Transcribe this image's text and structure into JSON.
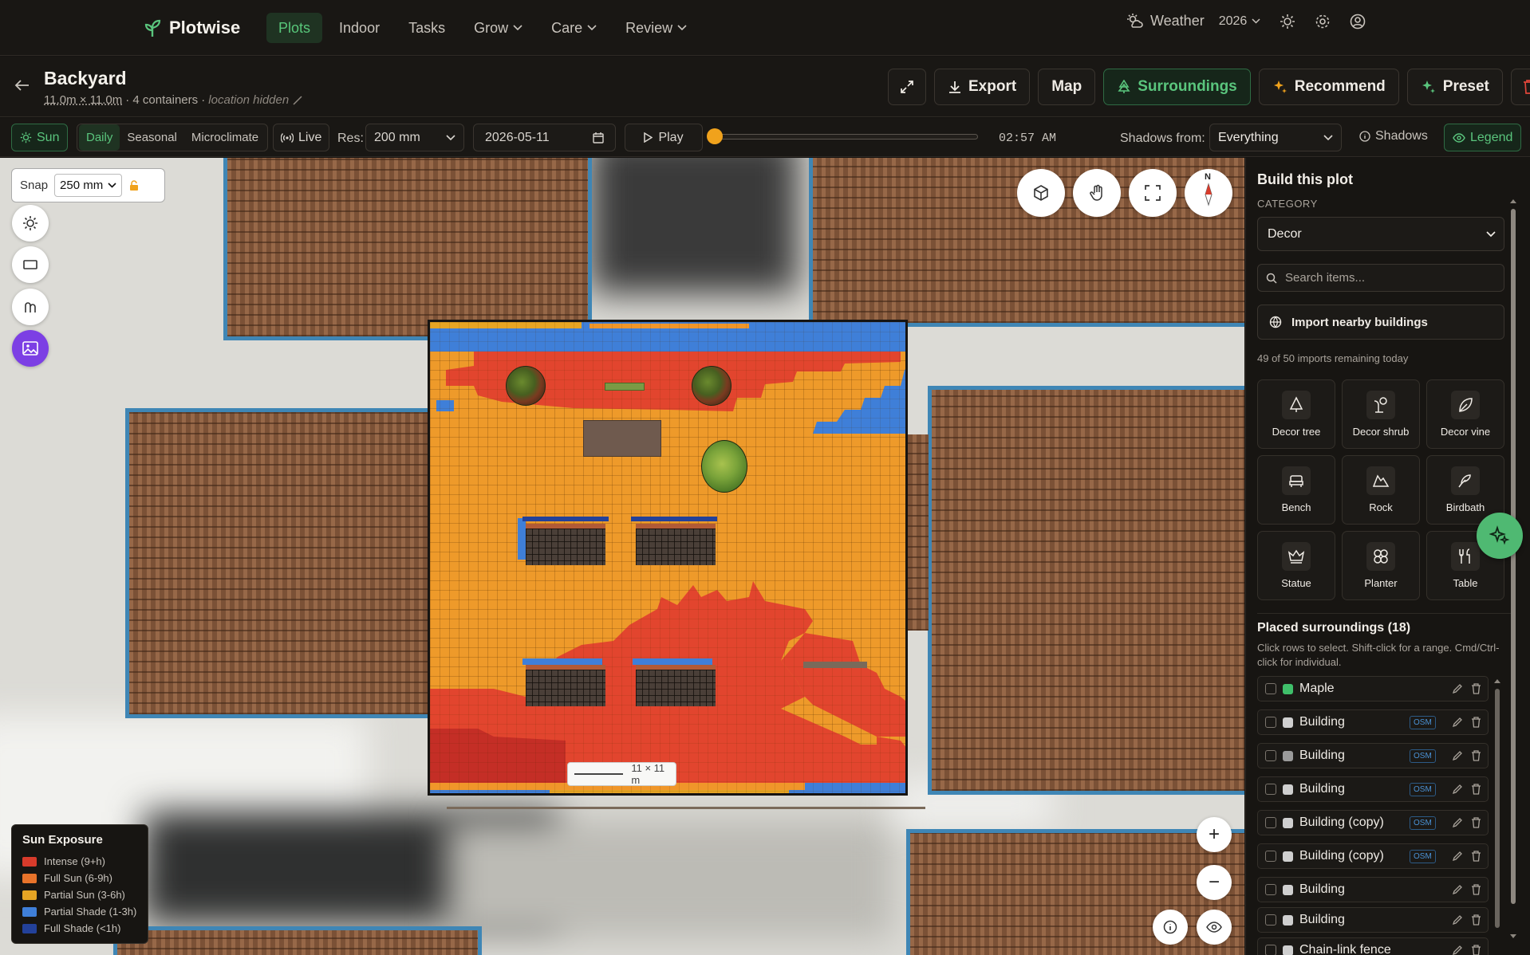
{
  "nav": {
    "brand": "Plotwise",
    "items": [
      {
        "label": "Plots",
        "active": true
      },
      {
        "label": "Indoor"
      },
      {
        "label": "Tasks"
      },
      {
        "label": "Grow",
        "dropdown": true
      },
      {
        "label": "Care",
        "dropdown": true
      },
      {
        "label": "Review",
        "dropdown": true
      }
    ],
    "weather": "Weather",
    "year": "2026"
  },
  "header": {
    "title": "Backyard",
    "dimensions": "11.0m × 11.0m",
    "containers": "· 4 containers ·",
    "location": "location hidden",
    "buttons": {
      "export": "Export",
      "map": "Map",
      "surroundings": "Surroundings",
      "recommend": "Recommend",
      "preset": "Preset"
    }
  },
  "toolbar": {
    "sun": "Sun",
    "modes": [
      "Daily",
      "Seasonal",
      "Microclimate"
    ],
    "live": "Live",
    "res_label": "Res:",
    "res_value": "200 mm",
    "date": "2026-05-11",
    "play": "Play",
    "time": "02:57 AM",
    "time_fraction": 0.0,
    "shadows_from_label": "Shadows from:",
    "shadows_from_value": "Everything",
    "shadows": "Shadows",
    "legend": "Legend"
  },
  "map": {
    "snap_label": "Snap",
    "snap_value": "250 mm",
    "compass": "N",
    "scale": "11 × 11 m",
    "zoom_in": "+",
    "zoom_out": "−"
  },
  "legend": {
    "title": "Sun Exposure",
    "items": [
      {
        "label": "Intense (9+h)",
        "color": "#d83b2b"
      },
      {
        "label": "Full Sun (6-9h)",
        "color": "#e8732a"
      },
      {
        "label": "Partial Sun (3-6h)",
        "color": "#e6a524"
      },
      {
        "label": "Partial Shade (1-3h)",
        "color": "#3f7fd8"
      },
      {
        "label": "Full Shade (<1h)",
        "color": "#23419a"
      }
    ]
  },
  "panel": {
    "title": "Build this plot",
    "category_label": "CATEGORY",
    "category_value": "Decor",
    "search_placeholder": "Search items...",
    "import_button": "Import nearby buildings",
    "imports_remaining": "49 of 50 imports remaining today",
    "items": [
      {
        "label": "Decor tree",
        "icon": "tree-icon"
      },
      {
        "label": "Decor shrub",
        "icon": "shrub-icon"
      },
      {
        "label": "Decor vine",
        "icon": "vine-icon"
      },
      {
        "label": "Bench",
        "icon": "bench-icon"
      },
      {
        "label": "Rock",
        "icon": "rock-icon"
      },
      {
        "label": "Birdbath",
        "icon": "birdbath-icon"
      },
      {
        "label": "Statue",
        "icon": "statue-icon"
      },
      {
        "label": "Planter",
        "icon": "planter-icon"
      },
      {
        "label": "Table",
        "icon": "table-icon"
      }
    ],
    "placed_title": "Placed surroundings (18)",
    "placed_help": "Click rows to select. Shift-click for a range. Cmd/Ctrl-click for individual.",
    "placed": [
      {
        "name": "Maple",
        "color": "#3fbf6a",
        "osm": false
      },
      {
        "name": "Building",
        "color": "#cfcfcf",
        "osm": true
      },
      {
        "name": "Building",
        "color": "#9a9a9a",
        "osm": true
      },
      {
        "name": "Building",
        "color": "#cfcfcf",
        "osm": true
      },
      {
        "name": "Building (copy)",
        "color": "#cfcfcf",
        "osm": true
      },
      {
        "name": "Building (copy)",
        "color": "#cfcfcf",
        "osm": true
      },
      {
        "name": "Building",
        "color": "#cfcfcf",
        "osm": false
      },
      {
        "name": "Building",
        "color": "#cfcfcf",
        "osm": false
      },
      {
        "name": "Chain-link fence",
        "color": "#cfcfcf",
        "osm": false
      }
    ],
    "osm_badge": "OSM"
  }
}
